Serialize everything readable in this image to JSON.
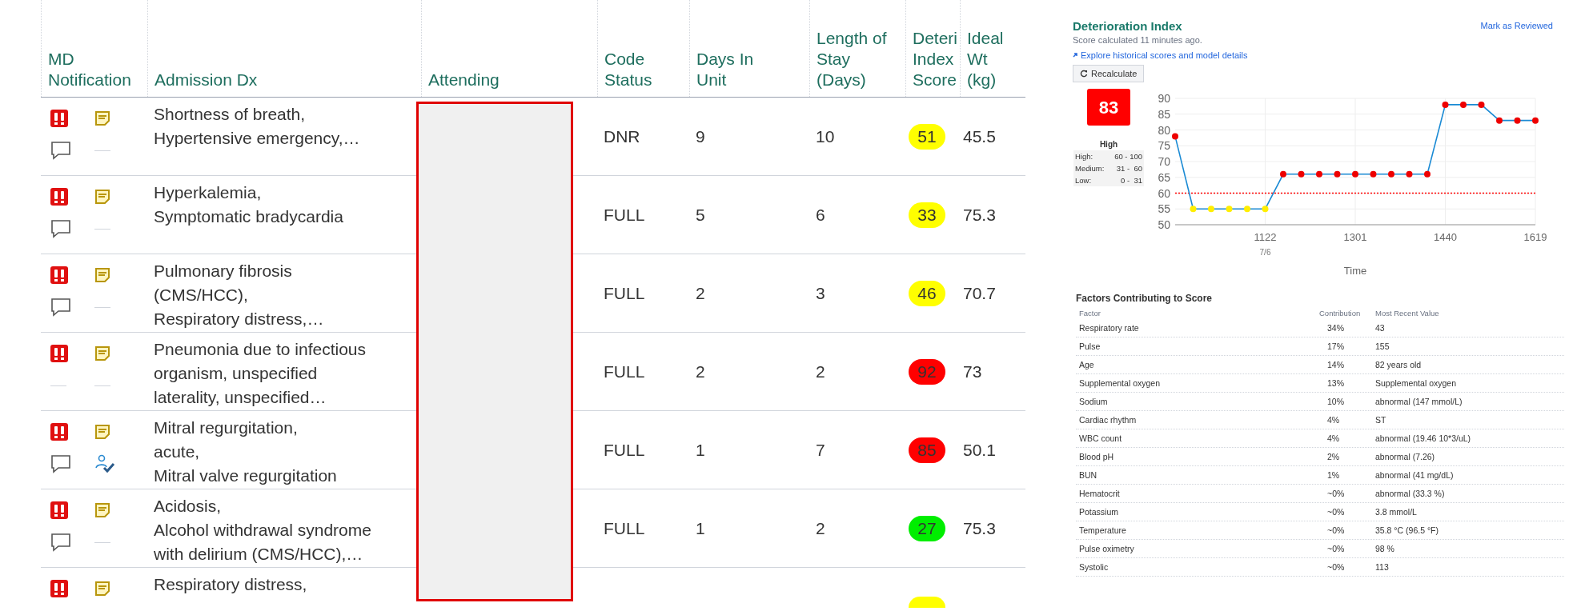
{
  "patient_list": {
    "columns": [
      {
        "lines": [
          "MD",
          "Notification"
        ]
      },
      {
        "lines": [
          "Admission Dx"
        ]
      },
      {
        "lines": [
          "Attending"
        ]
      },
      {
        "lines": [
          "Code",
          "Status"
        ]
      },
      {
        "lines": [
          "Days In",
          "Unit"
        ]
      },
      {
        "lines": [
          "Length of",
          "Stay",
          "(Days)"
        ]
      },
      {
        "lines": [
          "Deteri",
          "Index",
          "Score"
        ]
      },
      {
        "lines": [
          "Ideal",
          "Wt",
          "(kg)"
        ]
      }
    ],
    "rows": [
      {
        "icons": [
          {
            "kind": "alert"
          },
          {
            "kind": "note"
          },
          {
            "kind": "comment"
          },
          {
            "kind": "none"
          }
        ],
        "dx": [
          "Shortness of breath,",
          "Hypertensive emergency,…"
        ],
        "code_status": "DNR",
        "days_in_unit": "9",
        "length_of_stay": "10",
        "score": {
          "value": "51",
          "color": "#ffff00"
        },
        "ideal_wt": "45.5"
      },
      {
        "icons": [
          {
            "kind": "alert"
          },
          {
            "kind": "note"
          },
          {
            "kind": "comment"
          },
          {
            "kind": "none"
          }
        ],
        "dx": [
          "Hyperkalemia,",
          "Symptomatic bradycardia"
        ],
        "code_status": "FULL",
        "days_in_unit": "5",
        "length_of_stay": "6",
        "score": {
          "value": "33",
          "color": "#ffff00"
        },
        "ideal_wt": "75.3"
      },
      {
        "icons": [
          {
            "kind": "alert"
          },
          {
            "kind": "note"
          },
          {
            "kind": "comment"
          },
          {
            "kind": "none"
          }
        ],
        "dx": [
          "Pulmonary fibrosis",
          "(CMS/HCC),",
          "Respiratory distress,…"
        ],
        "code_status": "FULL",
        "days_in_unit": "2",
        "length_of_stay": "3",
        "score": {
          "value": "46",
          "color": "#ffff00"
        },
        "ideal_wt": "70.7"
      },
      {
        "icons": [
          {
            "kind": "alert"
          },
          {
            "kind": "note"
          },
          {
            "kind": "none"
          },
          {
            "kind": "none"
          }
        ],
        "dx": [
          "Pneumonia due to infectious",
          "organism, unspecified",
          "laterality, unspecified…"
        ],
        "code_status": "FULL",
        "days_in_unit": "2",
        "length_of_stay": "2",
        "score": {
          "value": "92",
          "color": "#ff0000"
        },
        "ideal_wt": "73"
      },
      {
        "icons": [
          {
            "kind": "alert"
          },
          {
            "kind": "note"
          },
          {
            "kind": "comment"
          },
          {
            "kind": "reviewed"
          }
        ],
        "dx": [
          "Mitral regurgitation,",
          "acute,",
          "Mitral valve regurgitation"
        ],
        "code_status": "FULL",
        "days_in_unit": "1",
        "length_of_stay": "7",
        "score": {
          "value": "85",
          "color": "#ff0000"
        },
        "ideal_wt": "50.1"
      },
      {
        "icons": [
          {
            "kind": "alert"
          },
          {
            "kind": "note"
          },
          {
            "kind": "comment"
          },
          {
            "kind": "none"
          }
        ],
        "dx": [
          "Acidosis,",
          "Alcohol withdrawal syndrome",
          "with delirium (CMS/HCC),…"
        ],
        "code_status": "FULL",
        "days_in_unit": "1",
        "length_of_stay": "2",
        "score": {
          "value": "27",
          "color": "#00ee00"
        },
        "ideal_wt": "75.3"
      },
      {
        "icons": [
          {
            "kind": "alert"
          },
          {
            "kind": "note"
          }
        ],
        "dx": [
          "Respiratory distress,"
        ],
        "score": {
          "color": "#ffff00"
        }
      }
    ]
  },
  "deterioration_panel": {
    "title": "Deterioration Index",
    "subtitle": "Score calculated 11 minutes ago.",
    "explore_link": "Explore historical scores and model details",
    "recalculate_button": "Recalculate",
    "mark_reviewed_link": "Mark as Reviewed",
    "score": {
      "value": "83",
      "color": "#ff0000",
      "category": "High"
    },
    "legend": [
      {
        "label": "High:",
        "range": "60 - 100"
      },
      {
        "label": "Medium:",
        "range": "31 -  60"
      },
      {
        "label": "Low:",
        "range": "0 -  31"
      }
    ],
    "chart_date": "7/6",
    "chart_data": {
      "type": "line",
      "xlabel": "Time",
      "categories": [
        null,
        null,
        null,
        null,
        null,
        "1122",
        null,
        null,
        null,
        null,
        "1301",
        null,
        null,
        null,
        null,
        "1440",
        null,
        null,
        null,
        null,
        "1619"
      ],
      "grid": true,
      "series": [
        {
          "color": "#1a8ad4",
          "marker": true,
          "values": [
            78,
            55,
            55,
            55,
            55,
            55,
            66,
            66,
            66,
            66,
            66,
            66,
            66,
            66,
            66,
            88,
            88,
            88,
            83,
            83,
            83
          ]
        }
      ],
      "ylim": [
        50,
        90
      ],
      "yticks": [
        50,
        55,
        60,
        65,
        70,
        75,
        80,
        85,
        90
      ],
      "ref_lines": [
        {
          "axis": "y",
          "value": 60,
          "color": "#ff0000"
        }
      ]
    },
    "factors": {
      "title": "Factors Contributing to Score",
      "columns": [
        "Factor",
        "Contribution",
        "Most Recent Value"
      ],
      "rows": [
        [
          "Respiratory rate",
          "34%",
          "43"
        ],
        [
          "Pulse",
          "17%",
          "155"
        ],
        [
          "Age",
          "14%",
          "82 years old"
        ],
        [
          "Supplemental oxygen",
          "13%",
          "Supplemental oxygen"
        ],
        [
          "Sodium",
          "10%",
          "abnormal (147 mmol/L)"
        ],
        [
          "Cardiac rhythm",
          "4%",
          "ST"
        ],
        [
          "WBC count",
          "4%",
          "abnormal (19.46 10*3/uL)"
        ],
        [
          "Blood pH",
          "2%",
          "abnormal (7.26)"
        ],
        [
          "BUN",
          "1%",
          "abnormal (41 mg/dL)"
        ],
        [
          "Hematocrit",
          "~0%",
          "abnormal (33.3 %)"
        ],
        [
          "Potassium",
          "~0%",
          "3.8 mmol/L"
        ],
        [
          "Temperature",
          "~0%",
          "35.8 °C (96.5 °F)"
        ],
        [
          "Pulse oximetry",
          "~0%",
          "98 %"
        ],
        [
          "Systolic",
          "~0%",
          "113"
        ]
      ]
    }
  }
}
